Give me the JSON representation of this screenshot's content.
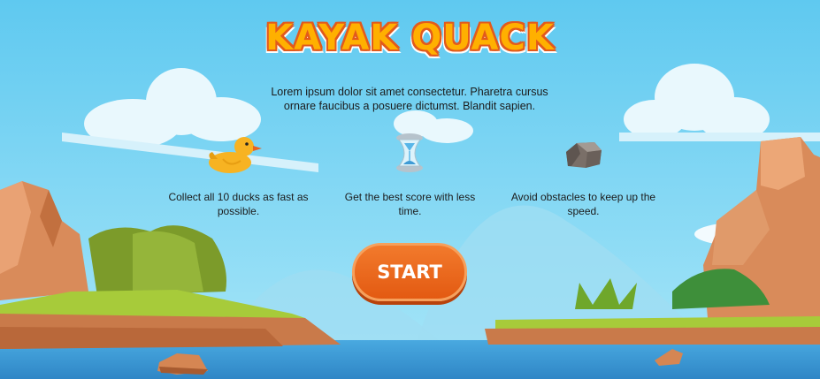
{
  "game": {
    "title": "KAYAK QUACK",
    "description": "Lorem ipsum dolor sit amet consectetur. Pharetra cursus ornare faucibus a posuere dictumst. Blandit sapien.",
    "tips": [
      {
        "icon": "duck-icon",
        "text": "Collect all 10 ducks as fast as possible."
      },
      {
        "icon": "hourglass-icon",
        "text": "Get the best score with less time."
      },
      {
        "icon": "rock-icon",
        "text": "Avoid obstacles to keep up the speed."
      }
    ],
    "start_label": "START"
  },
  "colors": {
    "sky": "#7DD6F3",
    "water": "#3E9DD8",
    "title_fill": "#FFB000",
    "title_outline": "#E25A1C",
    "button": "#E86A1E",
    "grass": "#9CC23A",
    "rock": "#D98B5A"
  }
}
